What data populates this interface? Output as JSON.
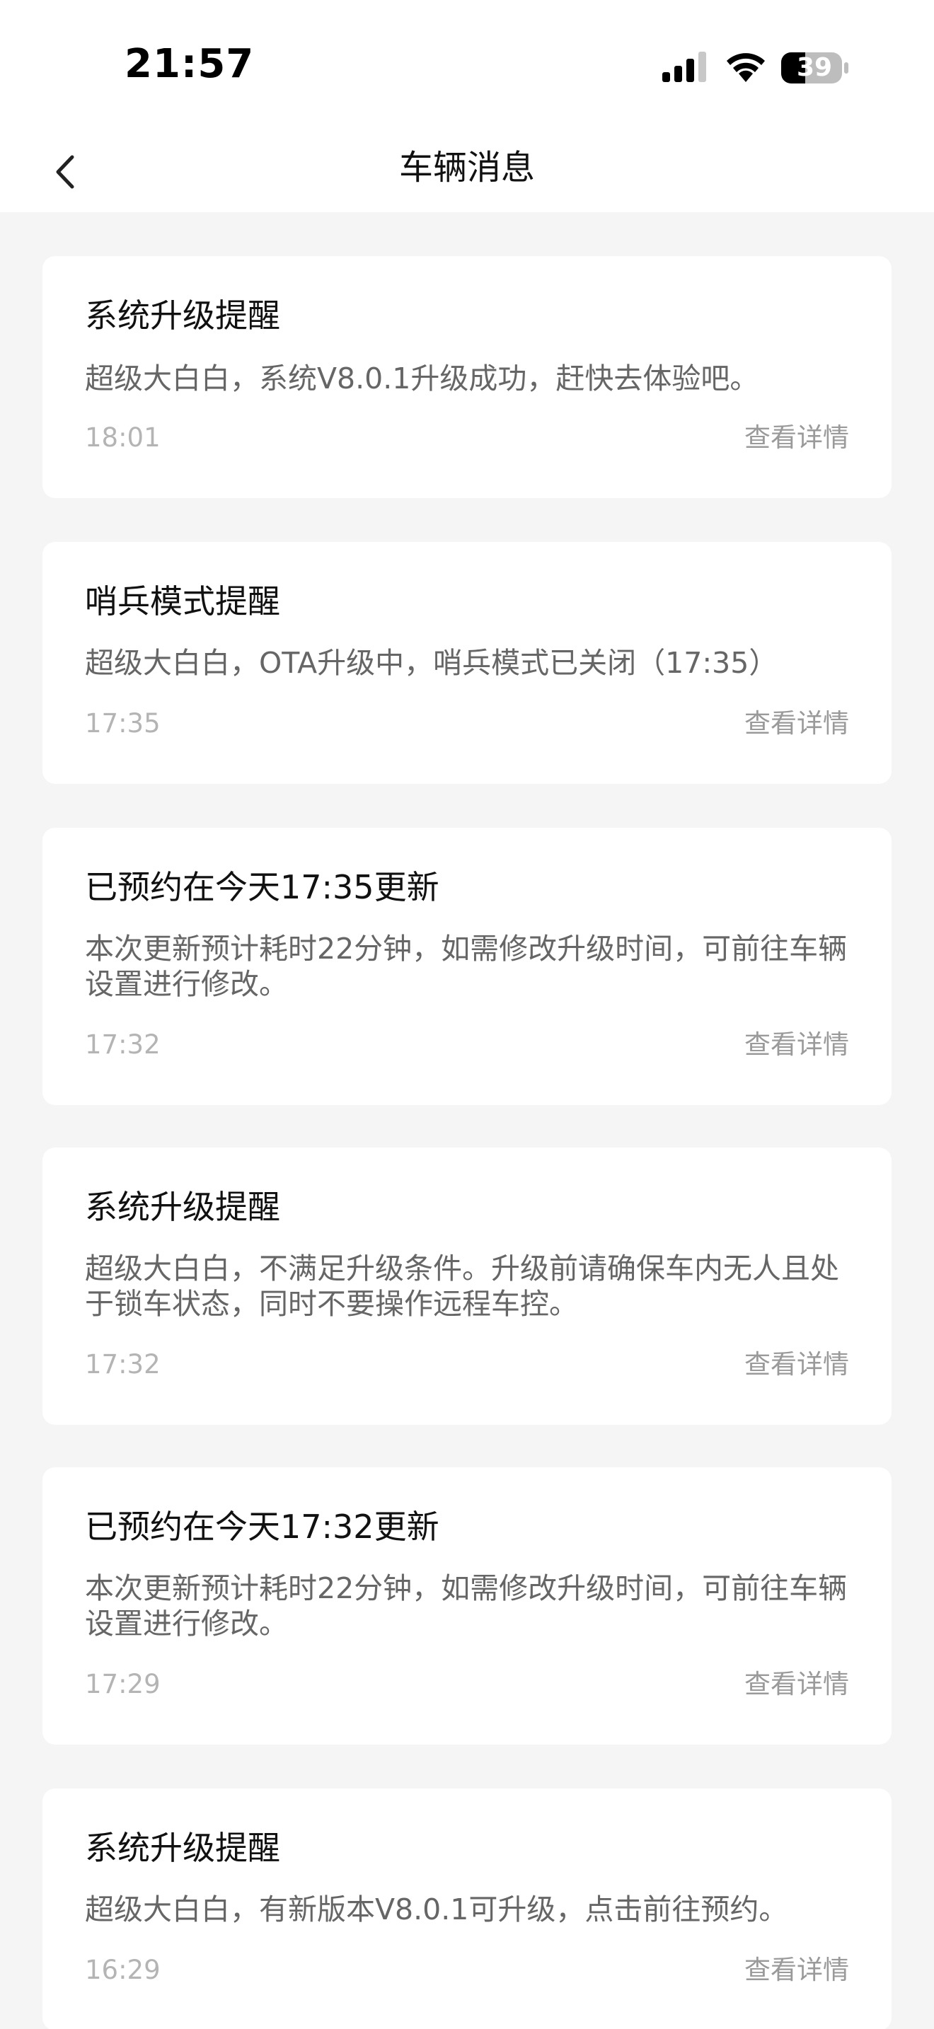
{
  "status_bar": {
    "time": "21:57",
    "battery": "39",
    "icons": [
      "signal-icon",
      "wifi-icon",
      "battery-icon"
    ]
  },
  "nav": {
    "title": "车辆消息",
    "back_icon": "chevron-left-icon"
  },
  "messages": [
    {
      "title": "系统升级提醒",
      "body": "超级大白白，系统V8.0.1升级成功，赶快去体验吧。",
      "time": "18:01",
      "detail": "查看详情"
    },
    {
      "title": "哨兵模式提醒",
      "body": "超级大白白，OTA升级中，哨兵模式已关闭（17:35）",
      "time": "17:35",
      "detail": "查看详情"
    },
    {
      "title": "已预约在今天17:35更新",
      "body": "本次更新预计耗时22分钟，如需修改升级时间，可前往车辆设置进行修改。",
      "time": "17:32",
      "detail": "查看详情"
    },
    {
      "title": "系统升级提醒",
      "body": "超级大白白，不满足升级条件。升级前请确保车内无人且处于锁车状态，同时不要操作远程车控。",
      "time": "17:32",
      "detail": "查看详情"
    },
    {
      "title": "已预约在今天17:32更新",
      "body": "本次更新预计耗时22分钟，如需修改升级时间，可前往车辆设置进行修改。",
      "time": "17:29",
      "detail": "查看详情"
    },
    {
      "title": "系统升级提醒",
      "body": "超级大白白，有新版本V8.0.1可升级，点击前往预约。",
      "time": "16:29",
      "detail": "查看详情"
    }
  ],
  "colors": {
    "background": "#f5f5f5",
    "card": "#ffffff",
    "title_text": "#111111",
    "body_text": "#666666",
    "muted_text": "#b4b4b4"
  }
}
